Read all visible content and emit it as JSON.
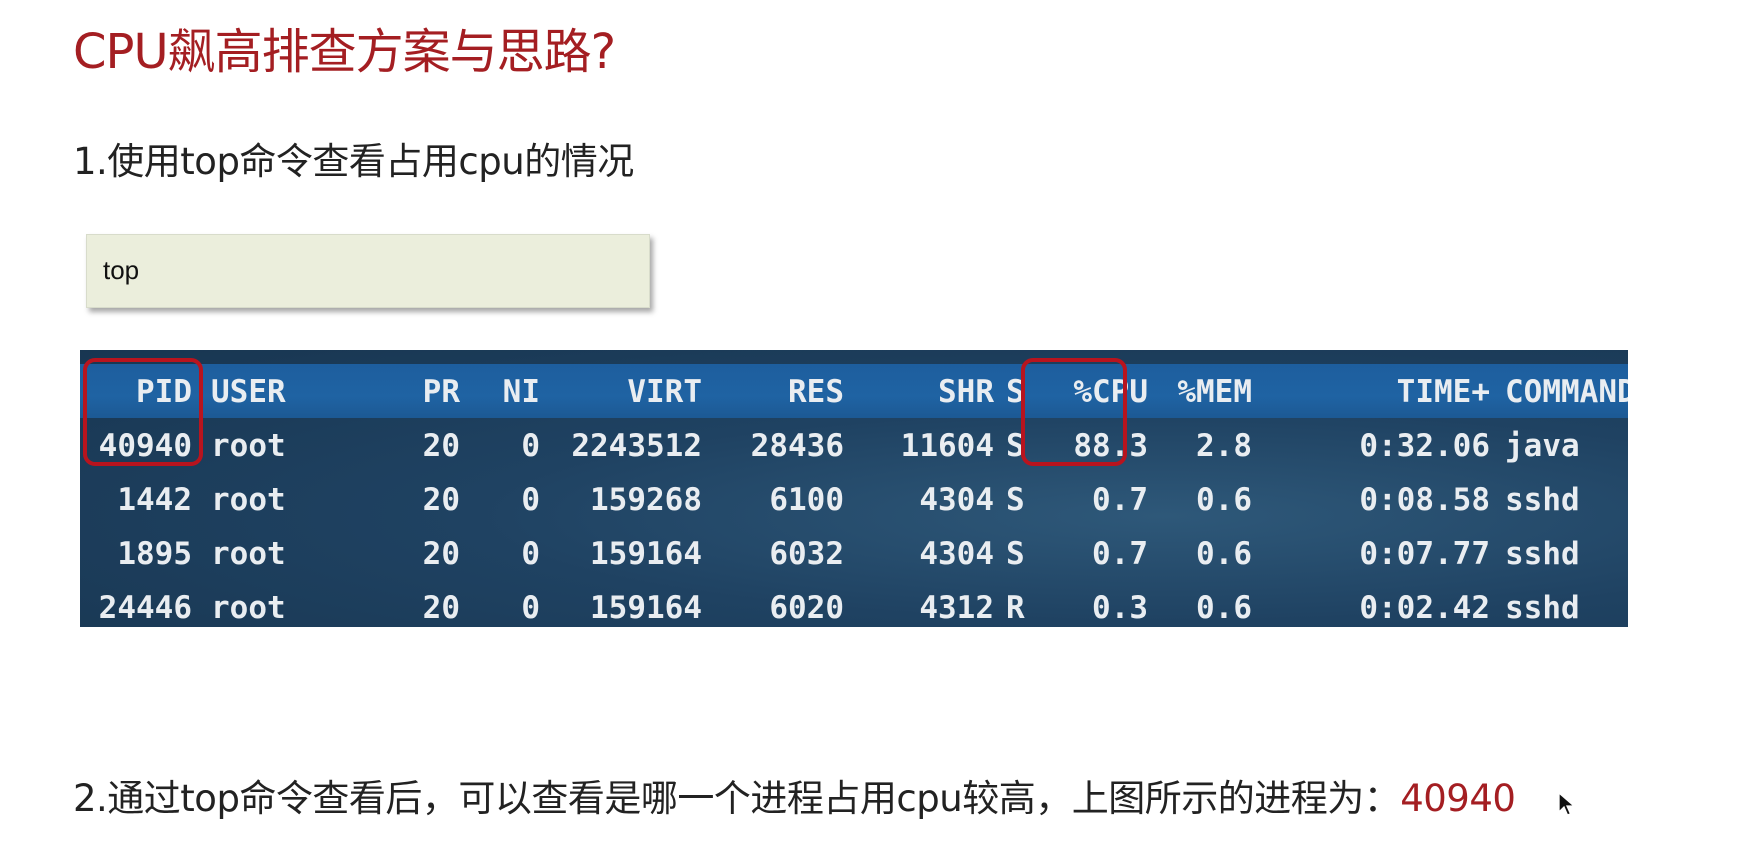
{
  "slide": {
    "title": "CPU飙高排查方案与思路?",
    "step1": "1.使用top命令查看占用cpu的情况",
    "command": "top",
    "step2_prefix": "2.通过top命令查看后，可以查看是哪一个进程占用cpu较高，上图所示的进程为：",
    "step2_pid": "40940"
  },
  "terminal": {
    "columns": [
      "PID",
      "USER",
      "PR",
      "NI",
      "VIRT",
      "RES",
      "SHR",
      "S",
      "%CPU",
      "%MEM",
      "TIME+",
      "COMMAND"
    ],
    "rows": [
      [
        "40940",
        "root",
        "20",
        "0",
        "2243512",
        "28436",
        "11604",
        "S",
        "88.3",
        "2.8",
        "0:32.06",
        "java"
      ],
      [
        "1442",
        "root",
        "20",
        "0",
        "159268",
        "6100",
        "4304",
        "S",
        "0.7",
        "0.6",
        "0:08.58",
        "sshd"
      ],
      [
        "1895",
        "root",
        "20",
        "0",
        "159164",
        "6032",
        "4304",
        "S",
        "0.7",
        "0.6",
        "0:07.77",
        "sshd"
      ],
      [
        "24446",
        "root",
        "20",
        "0",
        "159164",
        "6020",
        "4312",
        "R",
        "0.3",
        "0.6",
        "0:02.42",
        "sshd"
      ]
    ]
  },
  "colors": {
    "title": "#a41e22",
    "highlight_box": "#b8141e",
    "terminal_header": "#1f63a3",
    "terminal_bg": "#1f4262",
    "command_box": "#ebeedc"
  }
}
